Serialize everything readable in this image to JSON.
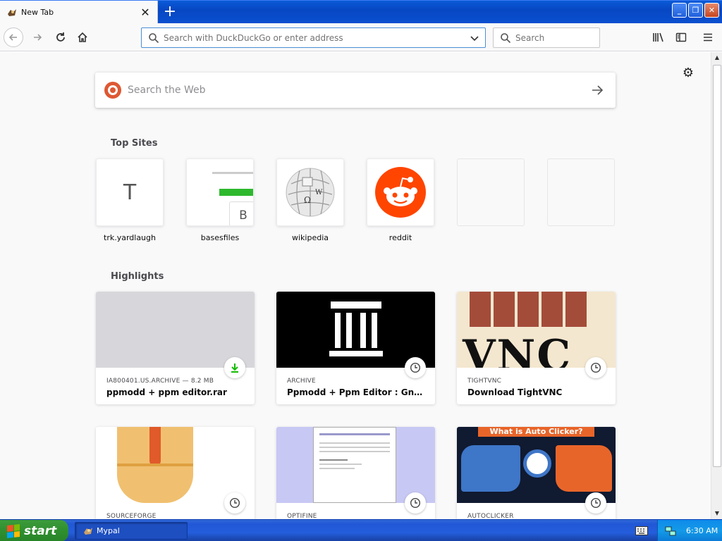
{
  "window": {
    "tab_title": "New Tab",
    "tab_close": "✕",
    "new_tab": "+",
    "minimize": "_",
    "restore": "❐",
    "close": "✕"
  },
  "toolbar": {
    "url_placeholder": "Search with DuckDuckGo or enter address",
    "search_placeholder": "Search"
  },
  "newtab": {
    "web_search_placeholder": "Search the Web",
    "top_sites_title": "Top Sites",
    "highlights_title": "Highlights",
    "top_sites": [
      {
        "label": "trk.yardlaugh",
        "letter": "T"
      },
      {
        "label": "basesfiles",
        "letter": "B"
      },
      {
        "label": "wikipedia"
      },
      {
        "label": "reddit"
      },
      {
        "label": ""
      },
      {
        "label": ""
      }
    ],
    "highlights": [
      {
        "source": "IA800401.US.ARCHIVE — 8.2 MB",
        "title": "ppmodd + ppm editor.rar",
        "badge": "download-icon"
      },
      {
        "source": "ARCHIVE",
        "title": "Ppmodd + Ppm Editor : Gnta Mu...",
        "badge": "clock-icon"
      },
      {
        "source": "TIGHTVNC",
        "title": "Download TightVNC",
        "badge": "clock-icon"
      },
      {
        "source": "SOURCEFORGE",
        "title": "",
        "badge": "clock-icon"
      },
      {
        "source": "OPTIFINE",
        "title": "",
        "badge": "clock-icon"
      },
      {
        "source": "AUTOCLICKER",
        "title": "",
        "badge": "clock-icon",
        "thumb_text": "What is Auto Clicker?"
      }
    ],
    "tightvnc_thumb_text": "VNC"
  },
  "taskbar": {
    "start_label": "start",
    "task_label": "Mypal",
    "clock": "6:30 AM"
  },
  "colors": {
    "accent": "#0a84ff",
    "reddit": "#ff4500",
    "download_green": "#12bc00"
  }
}
